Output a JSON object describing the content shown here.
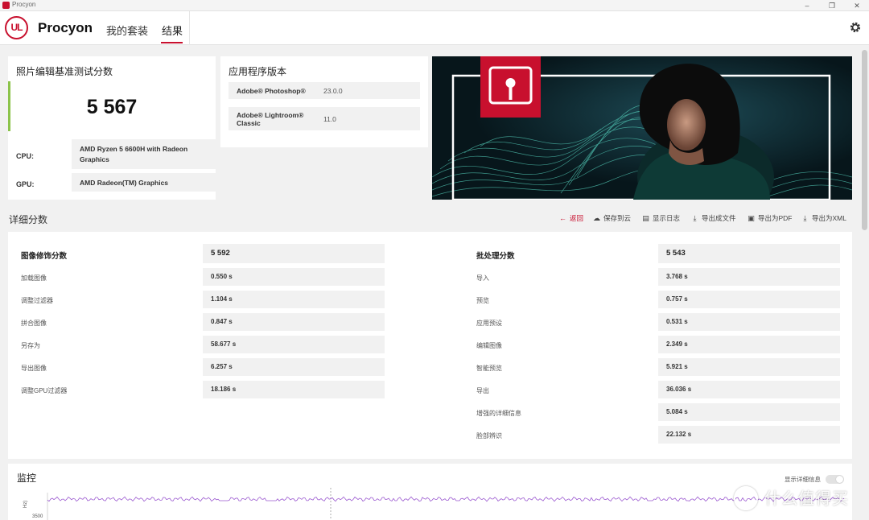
{
  "window": {
    "title": "Procyon"
  },
  "header": {
    "logo_text": "UL",
    "brand": "Procyon",
    "tabs": [
      {
        "label": "我的套装"
      },
      {
        "label": "结果",
        "active": true
      }
    ]
  },
  "score_card": {
    "title": "照片编辑基准测试分数",
    "score": "5 567",
    "cpu_label": "CPU:",
    "cpu_value": "AMD Ryzen 5 6600H with Radeon Graphics",
    "gpu_label": "GPU:",
    "gpu_value": "AMD Radeon(TM) Graphics"
  },
  "app_card": {
    "title": "应用程序版本",
    "apps": [
      {
        "name": "Adobe® Photoshop®",
        "version": "23.0.0"
      },
      {
        "name": "Adobe® Lightroom® Classic",
        "version": "11.0"
      }
    ]
  },
  "details": {
    "title": "详细分数",
    "actions": [
      {
        "label": "返回",
        "icon": "back-arrow-icon"
      },
      {
        "label": "保存到云",
        "icon": "cloud-upload-icon"
      },
      {
        "label": "显示日志",
        "icon": "document-icon"
      },
      {
        "label": "导出成文件",
        "icon": "download-icon"
      },
      {
        "label": "导出为PDF",
        "icon": "save-icon"
      },
      {
        "label": "导出为XML",
        "icon": "download-icon"
      }
    ],
    "groups": [
      {
        "title": "图像修饰分数",
        "score": "5 592",
        "metrics": [
          {
            "label": "加载图像",
            "value": "0.550 s"
          },
          {
            "label": "调整过滤器",
            "value": "1.104 s"
          },
          {
            "label": "拼合图像",
            "value": "0.847 s"
          },
          {
            "label": "另存为",
            "value": "58.677 s"
          },
          {
            "label": "导出图像",
            "value": "6.257 s"
          },
          {
            "label": "调整GPU过滤器",
            "value": "18.186 s"
          }
        ]
      },
      {
        "title": "批处理分数",
        "score": "5 543",
        "metrics": [
          {
            "label": "导入",
            "value": "3.768 s"
          },
          {
            "label": "预览",
            "value": "0.757 s"
          },
          {
            "label": "应用预设",
            "value": "0.531 s"
          },
          {
            "label": "编辑图像",
            "value": "2.349 s"
          },
          {
            "label": "智能预览",
            "value": "5.921 s"
          },
          {
            "label": "导出",
            "value": "36.036 s"
          },
          {
            "label": "增强的详细信息",
            "value": "5.084 s"
          },
          {
            "label": "脸部辨识",
            "value": "22.132 s"
          }
        ]
      }
    ]
  },
  "monitor": {
    "title": "监控",
    "toggle_label": "显示详细信息",
    "toggle_on": false,
    "y_unit": "Hz)",
    "y_tick": "3500"
  },
  "watermark": "什么值得买",
  "colors": {
    "accent": "#c8102e",
    "score_bar": "#8bc34a",
    "chart_line": "#9b59d0"
  }
}
